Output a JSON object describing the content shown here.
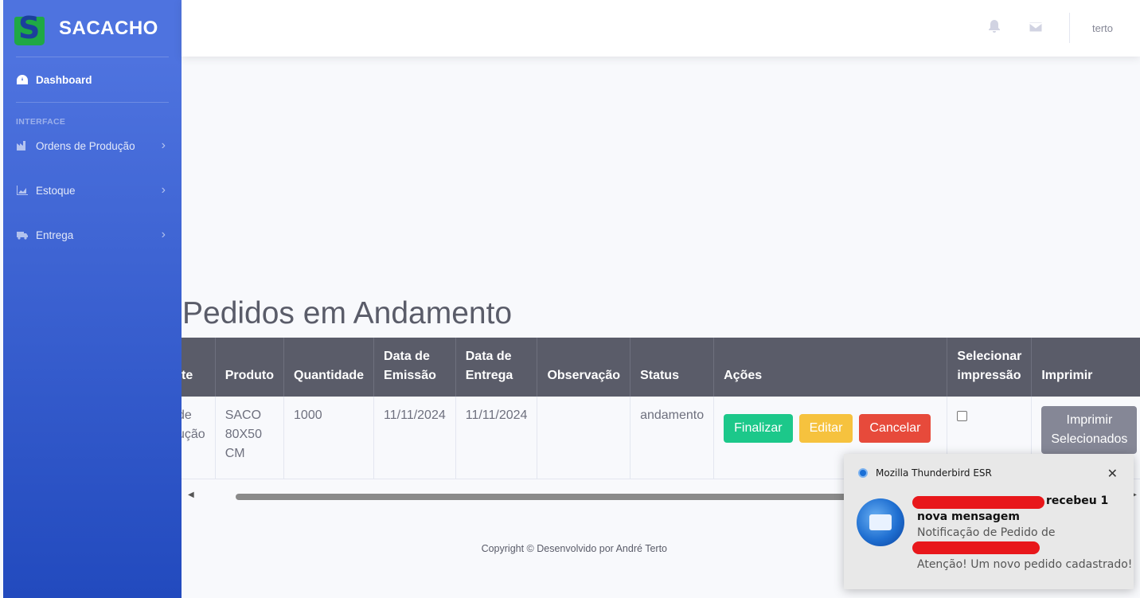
{
  "brand": {
    "logo_letter": "S",
    "name": "SACACHO"
  },
  "sidebar": {
    "dashboard": "Dashboard",
    "heading": "INTERFACE",
    "items": [
      {
        "label": "Ordens de Produção",
        "icon": "factory-icon"
      },
      {
        "label": "Estoque",
        "icon": "chart-area-icon"
      },
      {
        "label": "Entrega",
        "icon": "truck-icon"
      }
    ]
  },
  "topbar": {
    "user": "terto"
  },
  "main": {
    "title": "Pedidos em Andamento",
    "table": {
      "headers": [
        "te",
        "Produto",
        "Quantidade",
        "Data de Emissão",
        "Data de Entrega",
        "Observação",
        "Status",
        "Ações",
        "Selecionar impressão",
        "Imprimir"
      ],
      "row": {
        "col0": "de\nução",
        "produto": "SACO 80X50 CM",
        "quantidade": "1000",
        "emissao": "11/11/2024",
        "entrega": "11/11/2024",
        "observacao": "",
        "status": "andamento"
      },
      "actions": {
        "finalizar": "Finalizar",
        "editar": "Editar",
        "cancelar": "Cancelar"
      },
      "print_button": "Imprimir Selecionados"
    }
  },
  "footer": {
    "text": "Copyright © Desenvolvido por André Terto"
  },
  "notification": {
    "app": "Mozilla Thunderbird ESR",
    "line1_suffix": "recebeu 1",
    "line2": "nova mensagem",
    "line3": "Notificação de Pedido de",
    "line4": "Atenção! Um novo pedido cadastrado!"
  },
  "colors": {
    "sidebar_top": "#4e73df",
    "sidebar_bottom": "#224abe",
    "success": "#1cc88a",
    "warning": "#f6c23e",
    "danger": "#e74a3b",
    "redaction": "#e8171b"
  }
}
